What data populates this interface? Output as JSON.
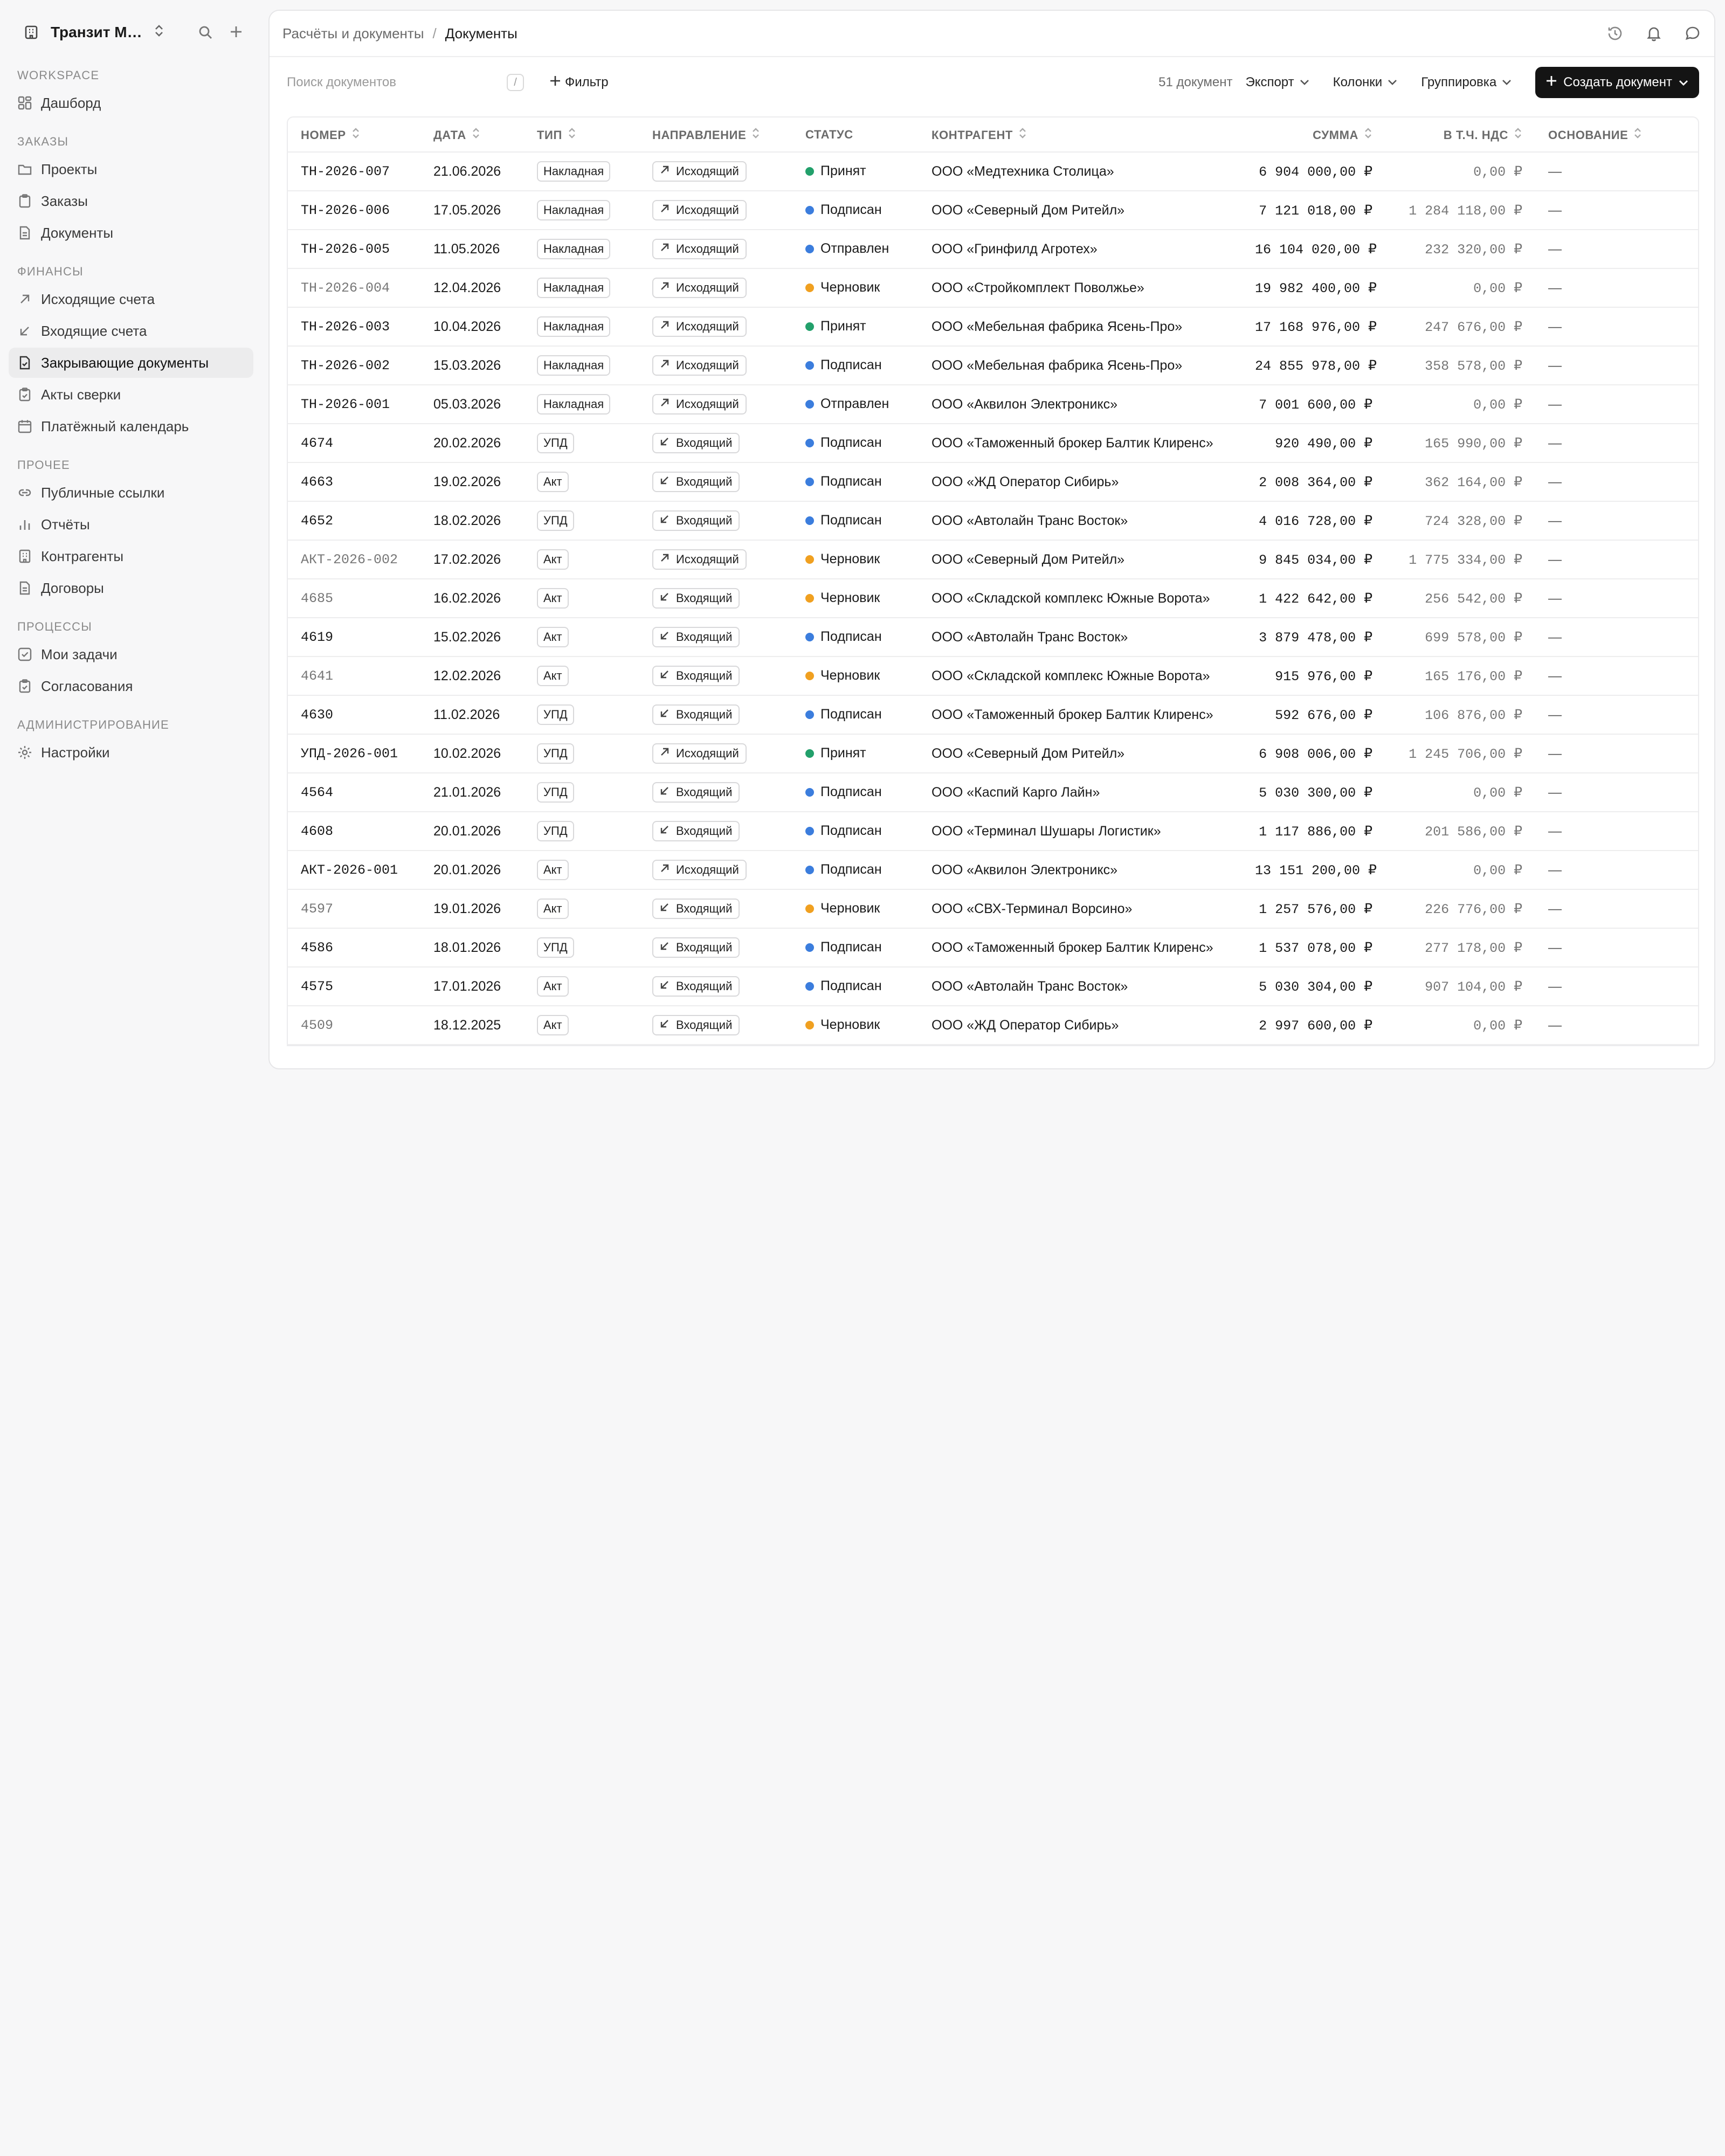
{
  "workspace": {
    "name": "Транзит Мер..."
  },
  "colors": {
    "accepted": "#22a06b",
    "signed": "#3b7ddd",
    "sent": "#3b7ddd",
    "draft": "#f0a020"
  },
  "sidebar": {
    "sections": [
      {
        "title": "WORKSPACE",
        "items": [
          {
            "label": "Дашборд",
            "icon": "dashboard-icon"
          }
        ]
      },
      {
        "title": "ЗАКАЗЫ",
        "items": [
          {
            "label": "Проекты",
            "icon": "folder-icon"
          },
          {
            "label": "Заказы",
            "icon": "clipboard-icon"
          },
          {
            "label": "Документы",
            "icon": "document-icon"
          }
        ]
      },
      {
        "title": "ФИНАНСЫ",
        "items": [
          {
            "label": "Исходящие счета",
            "icon": "arrow-up-right-icon"
          },
          {
            "label": "Входящие счета",
            "icon": "arrow-down-left-icon"
          },
          {
            "label": "Закрывающие документы",
            "icon": "document-check-icon",
            "active": true
          },
          {
            "label": "Акты сверки",
            "icon": "clipboard-check-icon"
          },
          {
            "label": "Платёжный календарь",
            "icon": "calendar-icon"
          }
        ]
      },
      {
        "title": "ПРОЧЕЕ",
        "items": [
          {
            "label": "Публичные ссылки",
            "icon": "link-icon"
          },
          {
            "label": "Отчёты",
            "icon": "bar-chart-icon"
          },
          {
            "label": "Контрагенты",
            "icon": "building-icon"
          },
          {
            "label": "Договоры",
            "icon": "document-icon"
          }
        ]
      },
      {
        "title": "ПРОЦЕССЫ",
        "items": [
          {
            "label": "Мои задачи",
            "icon": "checkbox-icon"
          },
          {
            "label": "Согласования",
            "icon": "clipboard-check-icon"
          }
        ]
      },
      {
        "title": "АДМИНИСТРИРОВАНИЕ",
        "items": [
          {
            "label": "Настройки",
            "icon": "gear-icon"
          }
        ]
      }
    ]
  },
  "header": {
    "crumb_parent": "Расчёты и документы",
    "crumb_sep": "/",
    "crumb_current": "Документы"
  },
  "toolbar": {
    "search_placeholder": "Поиск документов",
    "search_kbd": "/",
    "filter_label": "Фильтр",
    "doc_count": "51 документ",
    "export_label": "Экспорт",
    "columns_label": "Колонки",
    "group_label": "Группировка",
    "create_label": "Создать документ"
  },
  "table": {
    "columns": [
      "НОМЕР",
      "ДАТА",
      "ТИП",
      "НАПРАВЛЕНИЕ",
      "СТАТУС",
      "КОНТРАГЕНТ",
      "СУММА",
      "В Т.Ч. НДС",
      "ОСНОВАНИЕ"
    ],
    "rows": [
      {
        "number": "ТН-2026-007",
        "muted": false,
        "date": "21.06.2026",
        "type": "Накладная",
        "direction": "Исходящий",
        "dir": "out",
        "status": "Принят",
        "st": "accepted",
        "counterparty": "ООО «Медтехника Столица»",
        "amount": "6 904 000,00 ₽",
        "vat": "0,00 ₽",
        "basis": "—"
      },
      {
        "number": "ТН-2026-006",
        "muted": false,
        "date": "17.05.2026",
        "type": "Накладная",
        "direction": "Исходящий",
        "dir": "out",
        "status": "Подписан",
        "st": "signed",
        "counterparty": "ООО «Северный Дом Ритейл»",
        "amount": "7 121 018,00 ₽",
        "vat": "1 284 118,00 ₽",
        "basis": "—"
      },
      {
        "number": "ТН-2026-005",
        "muted": false,
        "date": "11.05.2026",
        "type": "Накладная",
        "direction": "Исходящий",
        "dir": "out",
        "status": "Отправлен",
        "st": "sent",
        "counterparty": "ООО «Гринфилд Агротех»",
        "amount": "16 104 020,00 ₽",
        "vat": "232 320,00 ₽",
        "basis": "—"
      },
      {
        "number": "ТН-2026-004",
        "muted": true,
        "date": "12.04.2026",
        "type": "Накладная",
        "direction": "Исходящий",
        "dir": "out",
        "status": "Черновик",
        "st": "draft",
        "counterparty": "ООО «Стройкомплект Поволжье»",
        "amount": "19 982 400,00 ₽",
        "vat": "0,00 ₽",
        "basis": "—"
      },
      {
        "number": "ТН-2026-003",
        "muted": false,
        "date": "10.04.2026",
        "type": "Накладная",
        "direction": "Исходящий",
        "dir": "out",
        "status": "Принят",
        "st": "accepted",
        "counterparty": "ООО «Мебельная фабрика Ясень-Про»",
        "amount": "17 168 976,00 ₽",
        "vat": "247 676,00 ₽",
        "basis": "—"
      },
      {
        "number": "ТН-2026-002",
        "muted": false,
        "date": "15.03.2026",
        "type": "Накладная",
        "direction": "Исходящий",
        "dir": "out",
        "status": "Подписан",
        "st": "signed",
        "counterparty": "ООО «Мебельная фабрика Ясень-Про»",
        "amount": "24 855 978,00 ₽",
        "vat": "358 578,00 ₽",
        "basis": "—"
      },
      {
        "number": "ТН-2026-001",
        "muted": false,
        "date": "05.03.2026",
        "type": "Накладная",
        "direction": "Исходящий",
        "dir": "out",
        "status": "Отправлен",
        "st": "sent",
        "counterparty": "ООО «Аквилон Электроникс»",
        "amount": "7 001 600,00 ₽",
        "vat": "0,00 ₽",
        "basis": "—"
      },
      {
        "number": "4674",
        "muted": false,
        "date": "20.02.2026",
        "type": "УПД",
        "direction": "Входящий",
        "dir": "in",
        "status": "Подписан",
        "st": "signed",
        "counterparty": "ООО «Таможенный брокер Балтик Клиренс»",
        "amount": "920 490,00 ₽",
        "vat": "165 990,00 ₽",
        "basis": "—"
      },
      {
        "number": "4663",
        "muted": false,
        "date": "19.02.2026",
        "type": "Акт",
        "direction": "Входящий",
        "dir": "in",
        "status": "Подписан",
        "st": "signed",
        "counterparty": "ООО «ЖД Оператор Сибирь»",
        "amount": "2 008 364,00 ₽",
        "vat": "362 164,00 ₽",
        "basis": "—"
      },
      {
        "number": "4652",
        "muted": false,
        "date": "18.02.2026",
        "type": "УПД",
        "direction": "Входящий",
        "dir": "in",
        "status": "Подписан",
        "st": "signed",
        "counterparty": "ООО «Автолайн Транс Восток»",
        "amount": "4 016 728,00 ₽",
        "vat": "724 328,00 ₽",
        "basis": "—"
      },
      {
        "number": "АКТ-2026-002",
        "muted": true,
        "date": "17.02.2026",
        "type": "Акт",
        "direction": "Исходящий",
        "dir": "out",
        "status": "Черновик",
        "st": "draft",
        "counterparty": "ООО «Северный Дом Ритейл»",
        "amount": "9 845 034,00 ₽",
        "vat": "1 775 334,00 ₽",
        "basis": "—"
      },
      {
        "number": "4685",
        "muted": true,
        "date": "16.02.2026",
        "type": "Акт",
        "direction": "Входящий",
        "dir": "in",
        "status": "Черновик",
        "st": "draft",
        "counterparty": "ООО «Складской комплекс Южные Ворота»",
        "amount": "1 422 642,00 ₽",
        "vat": "256 542,00 ₽",
        "basis": "—"
      },
      {
        "number": "4619",
        "muted": false,
        "date": "15.02.2026",
        "type": "Акт",
        "direction": "Входящий",
        "dir": "in",
        "status": "Подписан",
        "st": "signed",
        "counterparty": "ООО «Автолайн Транс Восток»",
        "amount": "3 879 478,00 ₽",
        "vat": "699 578,00 ₽",
        "basis": "—"
      },
      {
        "number": "4641",
        "muted": true,
        "date": "12.02.2026",
        "type": "Акт",
        "direction": "Входящий",
        "dir": "in",
        "status": "Черновик",
        "st": "draft",
        "counterparty": "ООО «Складской комплекс Южные Ворота»",
        "amount": "915 976,00 ₽",
        "vat": "165 176,00 ₽",
        "basis": "—"
      },
      {
        "number": "4630",
        "muted": false,
        "date": "11.02.2026",
        "type": "УПД",
        "direction": "Входящий",
        "dir": "in",
        "status": "Подписан",
        "st": "signed",
        "counterparty": "ООО «Таможенный брокер Балтик Клиренс»",
        "amount": "592 676,00 ₽",
        "vat": "106 876,00 ₽",
        "basis": "—"
      },
      {
        "number": "УПД-2026-001",
        "muted": false,
        "date": "10.02.2026",
        "type": "УПД",
        "direction": "Исходящий",
        "dir": "out",
        "status": "Принят",
        "st": "accepted",
        "counterparty": "ООО «Северный Дом Ритейл»",
        "amount": "6 908 006,00 ₽",
        "vat": "1 245 706,00 ₽",
        "basis": "—"
      },
      {
        "number": "4564",
        "muted": false,
        "date": "21.01.2026",
        "type": "УПД",
        "direction": "Входящий",
        "dir": "in",
        "status": "Подписан",
        "st": "signed",
        "counterparty": "ООО «Каспий Карго Лайн»",
        "amount": "5 030 300,00 ₽",
        "vat": "0,00 ₽",
        "basis": "—"
      },
      {
        "number": "4608",
        "muted": false,
        "date": "20.01.2026",
        "type": "УПД",
        "direction": "Входящий",
        "dir": "in",
        "status": "Подписан",
        "st": "signed",
        "counterparty": "ООО «Терминал Шушары Логистик»",
        "amount": "1 117 886,00 ₽",
        "vat": "201 586,00 ₽",
        "basis": "—"
      },
      {
        "number": "АКТ-2026-001",
        "muted": false,
        "date": "20.01.2026",
        "type": "Акт",
        "direction": "Исходящий",
        "dir": "out",
        "status": "Подписан",
        "st": "signed",
        "counterparty": "ООО «Аквилон Электроникс»",
        "amount": "13 151 200,00 ₽",
        "vat": "0,00 ₽",
        "basis": "—"
      },
      {
        "number": "4597",
        "muted": true,
        "date": "19.01.2026",
        "type": "Акт",
        "direction": "Входящий",
        "dir": "in",
        "status": "Черновик",
        "st": "draft",
        "counterparty": "ООО «СВХ-Терминал Ворсино»",
        "amount": "1 257 576,00 ₽",
        "vat": "226 776,00 ₽",
        "basis": "—"
      },
      {
        "number": "4586",
        "muted": false,
        "date": "18.01.2026",
        "type": "УПД",
        "direction": "Входящий",
        "dir": "in",
        "status": "Подписан",
        "st": "signed",
        "counterparty": "ООО «Таможенный брокер Балтик Клиренс»",
        "amount": "1 537 078,00 ₽",
        "vat": "277 178,00 ₽",
        "basis": "—"
      },
      {
        "number": "4575",
        "muted": false,
        "date": "17.01.2026",
        "type": "Акт",
        "direction": "Входящий",
        "dir": "in",
        "status": "Подписан",
        "st": "signed",
        "counterparty": "ООО «Автолайн Транс Восток»",
        "amount": "5 030 304,00 ₽",
        "vat": "907 104,00 ₽",
        "basis": "—"
      },
      {
        "number": "4509",
        "muted": true,
        "date": "18.12.2025",
        "type": "Акт",
        "direction": "Входящий",
        "dir": "in",
        "status": "Черновик",
        "st": "draft",
        "counterparty": "ООО «ЖД Оператор Сибирь»",
        "amount": "2 997 600,00 ₽",
        "vat": "0,00 ₽",
        "basis": "—"
      }
    ]
  }
}
